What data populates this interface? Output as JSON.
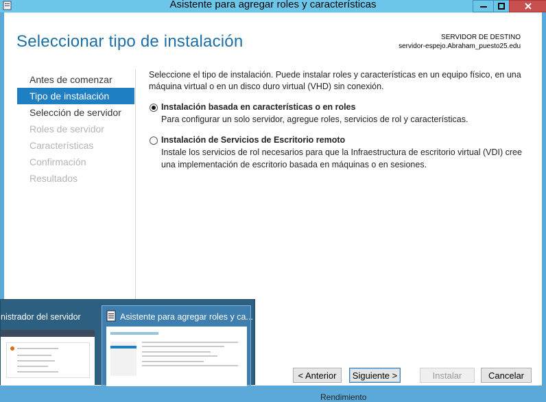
{
  "window": {
    "title": "Asistente para agregar roles y características",
    "controls": {
      "minimize": "minimize-icon",
      "maximize": "maximize-icon",
      "close": "close-icon"
    }
  },
  "header": {
    "page_title": "Seleccionar tipo de instalación",
    "destination_label": "SERVIDOR DE DESTINO",
    "destination_server": "servidor-espejo.Abraham_puesto25.edu"
  },
  "nav": {
    "items": [
      {
        "label": "Antes de comenzar",
        "state": "normal"
      },
      {
        "label": "Tipo de instalación",
        "state": "active"
      },
      {
        "label": "Selección de servidor",
        "state": "normal"
      },
      {
        "label": "Roles de servidor",
        "state": "disabled"
      },
      {
        "label": "Características",
        "state": "disabled"
      },
      {
        "label": "Confirmación",
        "state": "disabled"
      },
      {
        "label": "Resultados",
        "state": "disabled"
      }
    ]
  },
  "main": {
    "intro": "Seleccione el tipo de instalación. Puede instalar roles y características en un equipo físico, en una máquina virtual o en un disco duro virtual (VHD) sin conexión.",
    "options": [
      {
        "title": "Instalación basada en características o en roles",
        "description": "Para configurar un solo servidor, agregue roles, servicios de rol y características.",
        "selected": true
      },
      {
        "title": "Instalación de Servicios de Escritorio remoto",
        "description": "Instale los servicios de rol necesarios para que la Infraestructura de escritorio virtual (VDI) cree una implementación de escritorio basada en máquinas o en sesiones.",
        "selected": false
      }
    ]
  },
  "buttons": {
    "previous": "< Anterior",
    "next": "Siguiente >",
    "install": "Instalar",
    "cancel": "Cancelar"
  },
  "taskbar_preview": {
    "thumb1_label": "nistrador del servidor",
    "thumb2_label": "Asistente para agregar roles y ca..."
  },
  "background_text": "Rendimiento",
  "colors": {
    "accent": "#1e7fc2",
    "title_blue": "#1c6fa8",
    "titlebar": "#6cc6ea",
    "close": "#c7504f"
  }
}
